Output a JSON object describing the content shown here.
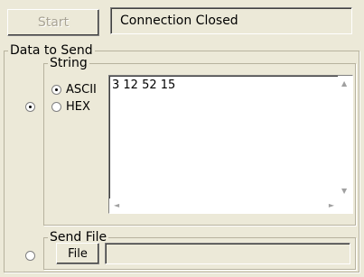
{
  "connection": {
    "start_label": "Start",
    "status_text": "Connection Closed"
  },
  "data_to_send": {
    "group_label": "Data to Send",
    "mode_string_selected": true,
    "string_group": {
      "label": "String",
      "ascii_label": "ASCII",
      "hex_label": "HEX",
      "format_selected": "ASCII",
      "text_value": "3 12 52 15"
    },
    "file_group": {
      "label": "Send File",
      "file_button_label": "File",
      "file_path_value": ""
    }
  },
  "icons": [
    "radio-icon",
    "scroll-up-arrow-icon",
    "scroll-down-arrow-icon",
    "scroll-left-arrow-icon",
    "scroll-right-arrow-icon"
  ]
}
